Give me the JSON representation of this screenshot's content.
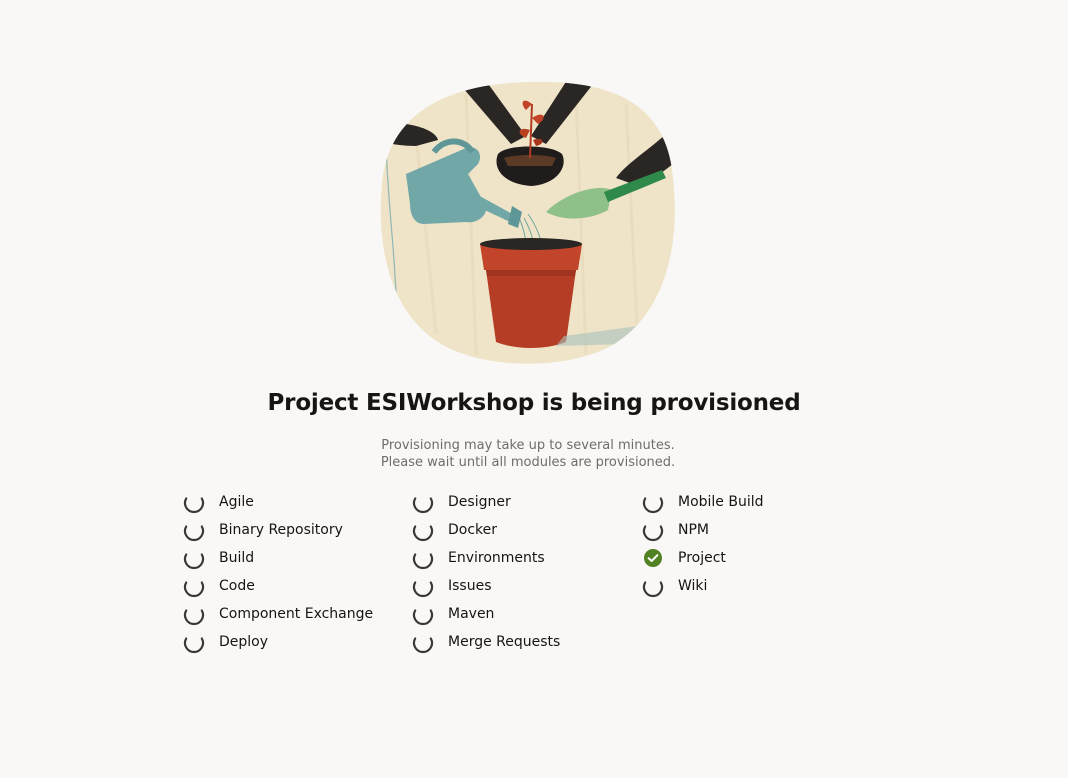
{
  "main": {
    "title": "Project ESIWorkshop is being provisioned",
    "subtitle_line1": "Provisioning may take up to several minutes.",
    "subtitle_line2": "Please wait until all modules are provisioned."
  },
  "colors": {
    "spinner": "#3a3835",
    "done": "#508223",
    "background": "#f9f8f6"
  },
  "modules": {
    "col1": [
      {
        "label": "Agile",
        "status": "pending",
        "icon": "spinner-icon"
      },
      {
        "label": "Binary Repository",
        "status": "pending",
        "icon": "spinner-icon"
      },
      {
        "label": "Build",
        "status": "pending",
        "icon": "spinner-icon"
      },
      {
        "label": "Code",
        "status": "pending",
        "icon": "spinner-icon"
      },
      {
        "label": "Component Exchange",
        "status": "pending",
        "icon": "spinner-icon"
      },
      {
        "label": "Deploy",
        "status": "pending",
        "icon": "spinner-icon"
      }
    ],
    "col2": [
      {
        "label": "Designer",
        "status": "pending",
        "icon": "spinner-icon"
      },
      {
        "label": "Docker",
        "status": "pending",
        "icon": "spinner-icon"
      },
      {
        "label": "Environments",
        "status": "pending",
        "icon": "spinner-icon"
      },
      {
        "label": "Issues",
        "status": "pending",
        "icon": "spinner-icon"
      },
      {
        "label": "Maven",
        "status": "pending",
        "icon": "spinner-icon"
      },
      {
        "label": "Merge Requests",
        "status": "pending",
        "icon": "spinner-icon"
      }
    ],
    "col3": [
      {
        "label": "Mobile Build",
        "status": "pending",
        "icon": "spinner-icon"
      },
      {
        "label": "NPM",
        "status": "pending",
        "icon": "spinner-icon"
      },
      {
        "label": "Project",
        "status": "done",
        "icon": "check-circle-icon"
      },
      {
        "label": "Wiki",
        "status": "pending",
        "icon": "spinner-icon"
      }
    ]
  }
}
